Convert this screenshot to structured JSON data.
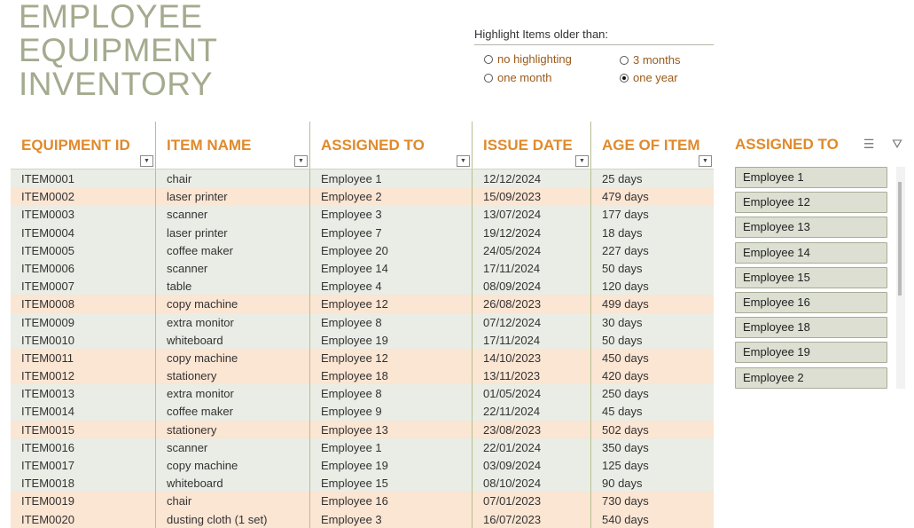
{
  "title": {
    "line1": "EMPLOYEE",
    "line2": "EQUIPMENT",
    "line3": "INVENTORY"
  },
  "highlight": {
    "label": "Highlight Items older than:",
    "options": [
      {
        "label": "no highlighting",
        "selected": false
      },
      {
        "label": "3 months",
        "selected": false
      },
      {
        "label": "one month",
        "selected": false
      },
      {
        "label": "one year",
        "selected": true
      }
    ]
  },
  "table": {
    "headers": [
      "EQUIPMENT ID",
      "ITEM NAME",
      "ASSIGNED TO",
      "ISSUE DATE",
      "AGE OF ITEM"
    ],
    "rows": [
      [
        "ITEM0001",
        "chair",
        "Employee 1",
        "12/12/2024",
        "25 days"
      ],
      [
        "ITEM0002",
        "laser printer",
        "Employee 2",
        "15/09/2023",
        "479 days"
      ],
      [
        "ITEM0003",
        "scanner",
        "Employee 3",
        "13/07/2024",
        "177 days"
      ],
      [
        "ITEM0004",
        "laser printer",
        "Employee 7",
        "19/12/2024",
        "18 days"
      ],
      [
        "ITEM0005",
        "coffee maker",
        "Employee 20",
        "24/05/2024",
        "227 days"
      ],
      [
        "ITEM0006",
        "scanner",
        "Employee 14",
        "17/11/2024",
        "50 days"
      ],
      [
        "ITEM0007",
        "table",
        "Employee 4",
        "08/09/2024",
        "120 days"
      ],
      [
        "ITEM0008",
        "copy machine",
        "Employee 12",
        "26/08/2023",
        "499 days"
      ],
      [
        "ITEM0009",
        "extra monitor",
        "Employee 8",
        "07/12/2024",
        "30 days"
      ],
      [
        "ITEM0010",
        "whiteboard",
        "Employee 19",
        "17/11/2024",
        "50 days"
      ],
      [
        "ITEM0011",
        "copy machine",
        "Employee 12",
        "14/10/2023",
        "450 days"
      ],
      [
        "ITEM0012",
        "stationery",
        "Employee 18",
        "13/11/2023",
        "420 days"
      ],
      [
        "ITEM0013",
        "extra monitor",
        "Employee 8",
        "01/05/2024",
        "250 days"
      ],
      [
        "ITEM0014",
        "coffee maker",
        "Employee 9",
        "22/11/2024",
        "45 days"
      ],
      [
        "ITEM0015",
        "stationery",
        "Employee 13",
        "23/08/2023",
        "502 days"
      ],
      [
        "ITEM0016",
        "scanner",
        "Employee 1",
        "22/01/2024",
        "350 days"
      ],
      [
        "ITEM0017",
        "copy machine",
        "Employee 19",
        "03/09/2024",
        "125 days"
      ],
      [
        "ITEM0018",
        "whiteboard",
        "Employee 15",
        "08/10/2024",
        "90 days"
      ],
      [
        "ITEM0019",
        "chair",
        "Employee 16",
        "07/01/2023",
        "730 days"
      ],
      [
        "ITEM0020",
        "dusting cloth (1 set)",
        "Employee 3",
        "16/07/2023",
        "540 days"
      ]
    ],
    "row_highlight": [
      "green",
      "orange",
      "green",
      "green",
      "green",
      "green",
      "green",
      "orange",
      "green",
      "green",
      "orange",
      "orange",
      "green",
      "green",
      "orange",
      "green",
      "green",
      "green",
      "orange",
      "orange"
    ]
  },
  "slicer": {
    "title": "ASSIGNED TO",
    "multiselect_icon": "multiselect-icon",
    "clear_filter_icon": "clear-filter-icon",
    "items": [
      "Employee 1",
      "Employee 12",
      "Employee 13",
      "Employee 14",
      "Employee 15",
      "Employee 16",
      "Employee 18",
      "Employee 19",
      "Employee 2"
    ]
  },
  "colors": {
    "title": "#a4ab8e",
    "header_accent": "#e08a2b",
    "row_green": "#e9ede5",
    "row_orange": "#fbe5d3",
    "radio_text": "#9b5a1a"
  }
}
